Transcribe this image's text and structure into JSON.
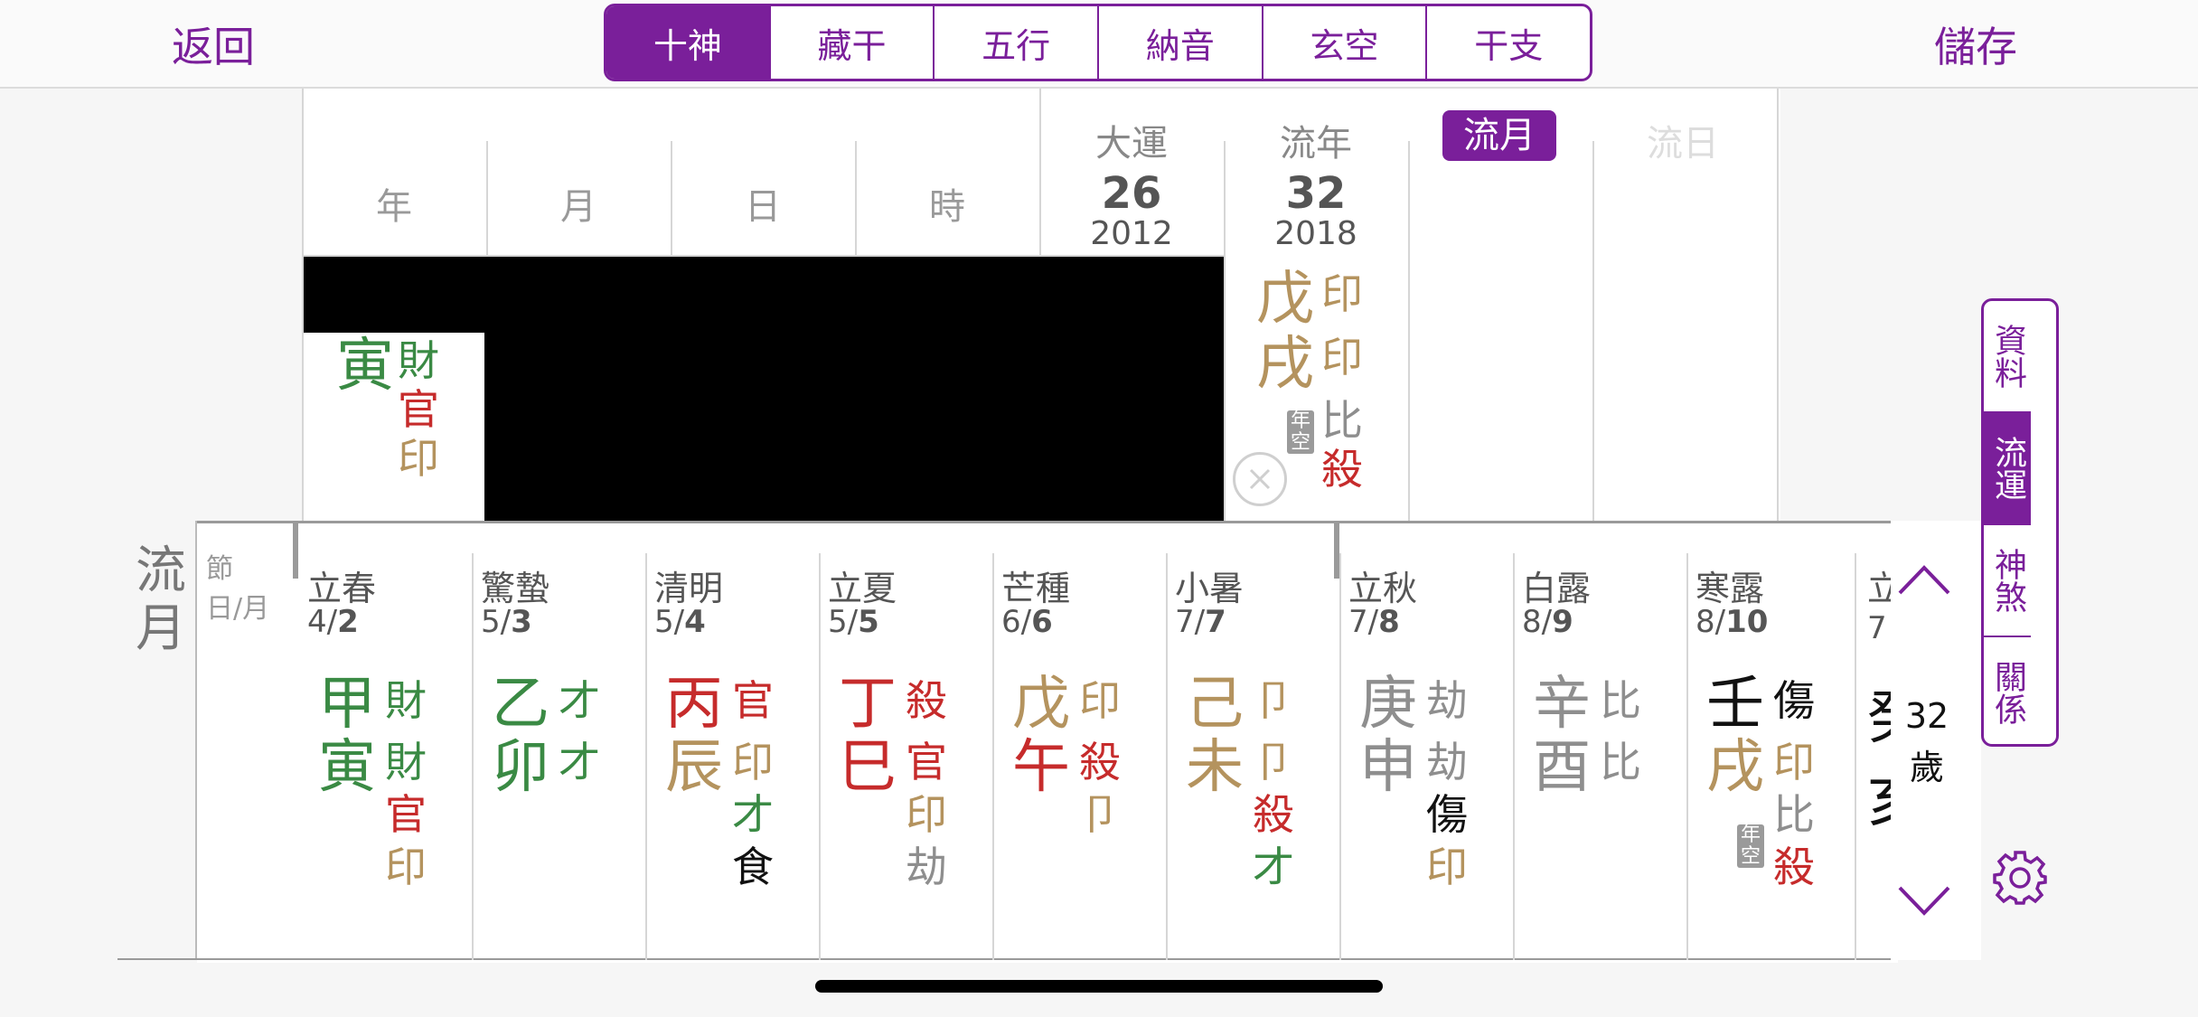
{
  "header": {
    "back": "返回",
    "save": "儲存",
    "tabs": [
      "十神",
      "藏干",
      "五行",
      "納音",
      "玄空",
      "干支"
    ]
  },
  "natal": {
    "pillar_headers": [
      "年",
      "月",
      "日",
      "時"
    ],
    "year_branch": "寅",
    "year_branch_gods": [
      "財",
      "官",
      "印"
    ]
  },
  "runs": {
    "dayun_label": "大運",
    "dayun_age": "26",
    "dayun_year": "2012",
    "liunian_label": "流年",
    "liunian_age": "32",
    "liunian_year": "2018",
    "liuyue_label": "流月",
    "liuri_label": "流日",
    "liunian_stem": "戊",
    "liunian_branch": "戌",
    "liunian_gods": [
      "印",
      "印",
      "比",
      "殺"
    ],
    "badge": "年空"
  },
  "monthly": {
    "section_label": "流月",
    "col_header_top": "節",
    "col_header_bottom": "日/月",
    "age_number": "32",
    "age_unit": "歲",
    "months": [
      {
        "term": "立春",
        "day": "4/",
        "mon": "2",
        "stem": "甲",
        "branch": "寅",
        "top_god": "財",
        "branch_gods": [
          "財",
          "官",
          "印"
        ]
      },
      {
        "term": "驚蟄",
        "day": "5/",
        "mon": "3",
        "stem": "乙",
        "branch": "卯",
        "top_god": "才",
        "branch_gods": [
          "才"
        ]
      },
      {
        "term": "清明",
        "day": "5/",
        "mon": "4",
        "stem": "丙",
        "branch": "辰",
        "top_god": "官",
        "branch_gods": [
          "印",
          "才",
          "食"
        ]
      },
      {
        "term": "立夏",
        "day": "5/",
        "mon": "5",
        "stem": "丁",
        "branch": "巳",
        "top_god": "殺",
        "branch_gods": [
          "官",
          "印",
          "劫"
        ]
      },
      {
        "term": "芒種",
        "day": "6/",
        "mon": "6",
        "stem": "戊",
        "branch": "午",
        "top_god": "印",
        "branch_gods": [
          "殺",
          "卩"
        ]
      },
      {
        "term": "小暑",
        "day": "7/",
        "mon": "7",
        "stem": "己",
        "branch": "未",
        "top_god": "卩",
        "branch_gods": [
          "卩",
          "殺",
          "才"
        ]
      },
      {
        "term": "立秋",
        "day": "7/",
        "mon": "8",
        "stem": "庚",
        "branch": "申",
        "top_god": "劫",
        "branch_gods": [
          "劫",
          "傷",
          "印"
        ]
      },
      {
        "term": "白露",
        "day": "8/",
        "mon": "9",
        "stem": "辛",
        "branch": "酉",
        "top_god": "比",
        "branch_gods": [
          "比"
        ]
      },
      {
        "term": "寒露",
        "day": "8/",
        "mon": "10",
        "stem": "壬",
        "branch": "戌",
        "top_god": "傷",
        "branch_gods": [
          "印",
          "比",
          "殺"
        ],
        "badge": "年空"
      }
    ]
  },
  "side_tabs": [
    "資料",
    "流運",
    "神煞",
    "關係"
  ],
  "colors": {
    "accent": "#7a1f9a",
    "wood": "#3a8a44",
    "fire": "#c62b2b",
    "earth": "#b4935e",
    "metal": "#8e8e8e",
    "water": "#111111"
  }
}
